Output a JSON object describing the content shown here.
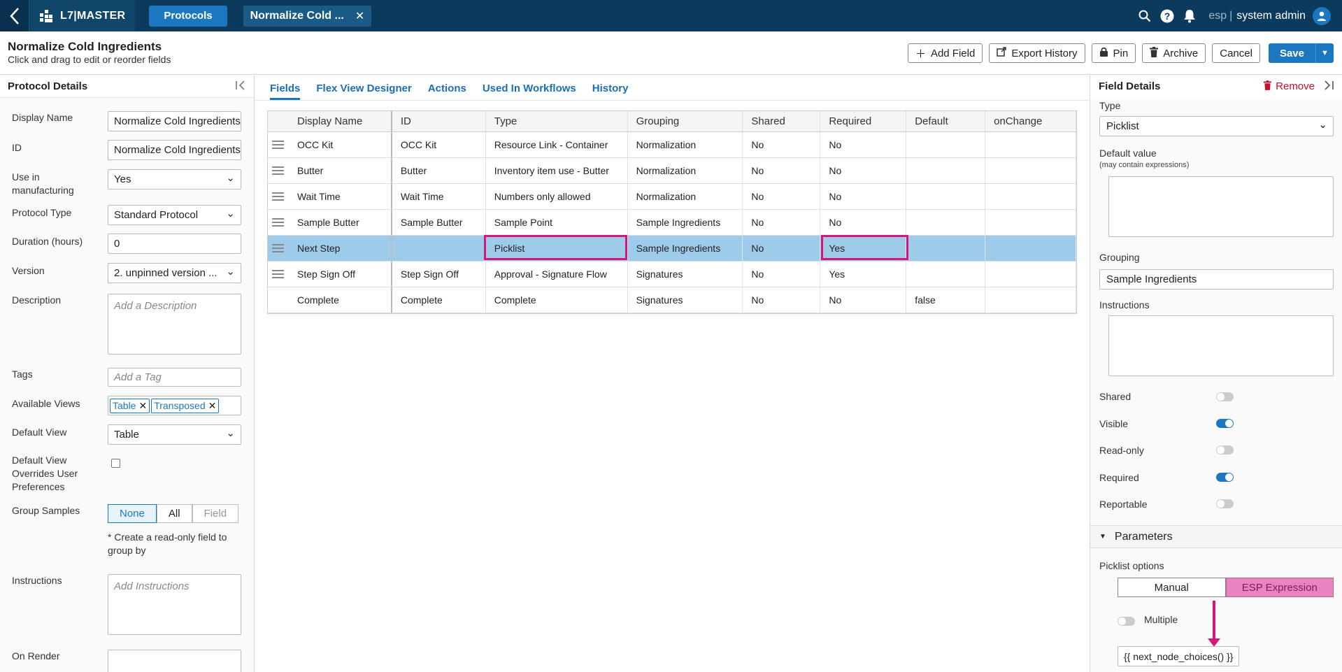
{
  "topbar": {
    "logo": "L7|MASTER",
    "nav_button": "Protocols",
    "doc_tab": "Normalize Cold ...",
    "lang": "esp",
    "sep": "|",
    "user": "system admin"
  },
  "header": {
    "title": "Normalize Cold Ingredients",
    "subtitle": "Click and drag to edit or reorder fields",
    "add_field": "Add Field",
    "export_history": "Export History",
    "pin": "Pin",
    "archive": "Archive",
    "cancel": "Cancel",
    "save": "Save"
  },
  "left": {
    "title": "Protocol Details",
    "display_name_label": "Display Name",
    "display_name": "Normalize Cold Ingredients",
    "id_label": "ID",
    "id": "Normalize Cold Ingredients",
    "use_mfg_label": "Use in manufacturing",
    "use_mfg": "Yes",
    "protocol_type_label": "Protocol Type",
    "protocol_type": "Standard Protocol",
    "duration_label": "Duration (hours)",
    "duration": "0",
    "version_label": "Version",
    "version": "2. unpinned version ...",
    "description_label": "Description",
    "description_placeholder": "Add a Description",
    "tags_label": "Tags",
    "tags_placeholder": "Add a Tag",
    "available_views_label": "Available Views",
    "views": [
      "Table",
      "Transposed"
    ],
    "default_view_label": "Default View",
    "default_view": "Table",
    "override_label": "Default View Overrides User Preferences",
    "group_samples_label": "Group Samples",
    "group_options": [
      "None",
      "All",
      "Field"
    ],
    "group_note": "* Create a read-only field to group by",
    "instructions_label": "Instructions",
    "instructions_placeholder": "Add Instructions",
    "on_render_label": "On Render"
  },
  "tabs": [
    "Fields",
    "Flex View Designer",
    "Actions",
    "Used In Workflows",
    "History"
  ],
  "grid": {
    "columns": [
      "Display Name",
      "ID",
      "Type",
      "Grouping",
      "Shared",
      "Required",
      "Default",
      "onChange"
    ],
    "rows": [
      [
        "OCC Kit",
        "OCC Kit",
        "Resource Link - Container",
        "Normalization",
        "No",
        "No",
        "",
        ""
      ],
      [
        "Butter",
        "Butter",
        "Inventory item use - Butter",
        "Normalization",
        "No",
        "No",
        "",
        ""
      ],
      [
        "Wait Time",
        "Wait Time",
        "Numbers only allowed",
        "Normalization",
        "No",
        "No",
        "",
        ""
      ],
      [
        "Sample Butter",
        "Sample Butter",
        "Sample Point",
        "Sample Ingredients",
        "No",
        "No",
        "",
        ""
      ],
      [
        "Next Step",
        "",
        "Picklist",
        "Sample Ingredients",
        "No",
        "Yes",
        "",
        ""
      ],
      [
        "Step Sign Off",
        "Step Sign Off",
        "Approval - Signature Flow",
        "Signatures",
        "No",
        "Yes",
        "",
        ""
      ],
      [
        "Complete",
        "Complete",
        "Complete",
        "Signatures",
        "No",
        "No",
        "false",
        ""
      ]
    ]
  },
  "right": {
    "title": "Field Details",
    "remove": "Remove",
    "type_label": "Type",
    "type": "Picklist",
    "default_label": "Default value",
    "default_hint": "(may contain expressions)",
    "grouping_label": "Grouping",
    "grouping": "Sample Ingredients",
    "instructions_label": "Instructions",
    "shared_label": "Shared",
    "visible_label": "Visible",
    "readonly_label": "Read-only",
    "required_label": "Required",
    "reportable_label": "Reportable",
    "parameters": "Parameters",
    "picklist_label": "Picklist options",
    "manual": "Manual",
    "esp_expression": "ESP Expression",
    "multiple": "Multiple",
    "expression": "{{ next_node_choices() }}"
  },
  "colors": {
    "accent": "#1b78c0",
    "highlight": "#d4177a",
    "selected_row": "#9fcbea"
  }
}
